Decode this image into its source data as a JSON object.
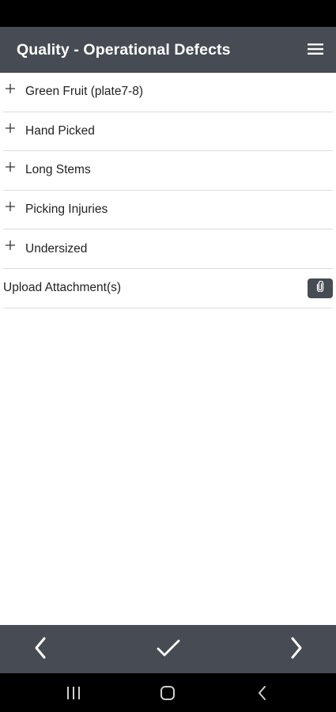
{
  "header": {
    "title": "Quality - Operational Defects",
    "menu_icon": "hamburger-menu-icon"
  },
  "defects": [
    {
      "label": "Green Fruit (plate7-8)",
      "icon": "plus-icon"
    },
    {
      "label": "Hand Picked",
      "icon": "plus-icon"
    },
    {
      "label": "Long Stems",
      "icon": "plus-icon"
    },
    {
      "label": "Picking Injuries",
      "icon": "plus-icon"
    },
    {
      "label": "Undersized",
      "icon": "plus-icon"
    }
  ],
  "upload": {
    "label": "Upload Attachment(s)",
    "icon": "paperclip-icon"
  },
  "footer": {
    "prev_icon": "chevron-left-icon",
    "confirm_icon": "checkmark-icon",
    "next_icon": "chevron-right-icon"
  },
  "system_nav": {
    "recents_icon": "recent-apps-icon",
    "home_icon": "home-icon",
    "back_icon": "back-icon"
  },
  "colors": {
    "header_bg": "#474c54",
    "divider": "#dcdcdc",
    "system_bar": "#000000"
  }
}
